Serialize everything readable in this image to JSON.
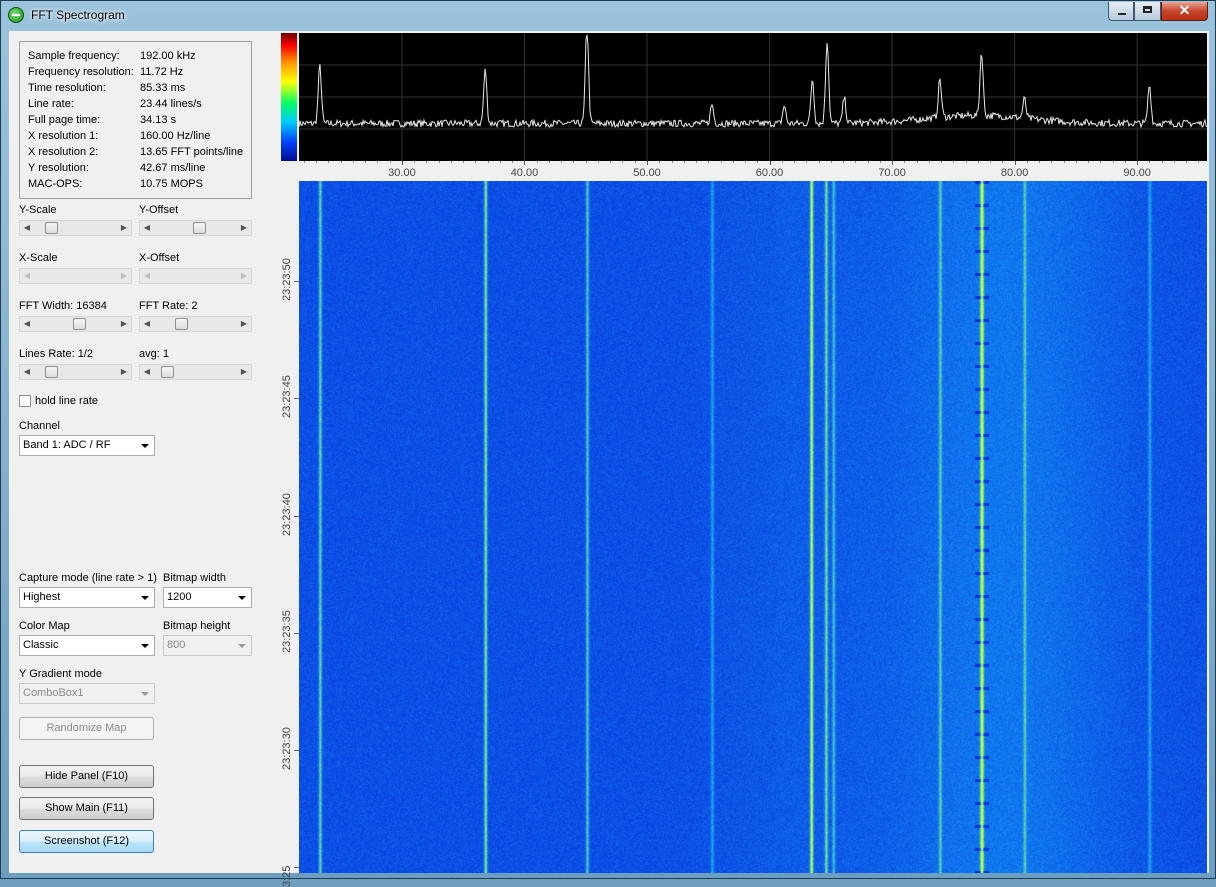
{
  "window": {
    "title": "FFT Spectrogram"
  },
  "info": [
    {
      "key": "Sample frequency:",
      "value": "192.00 kHz"
    },
    {
      "key": "Frequency resolution:",
      "value": "11.72 Hz"
    },
    {
      "key": "Time resolution:",
      "value": "85.33 ms"
    },
    {
      "key": "Line rate:",
      "value": "23.44 lines/s"
    },
    {
      "key": "Full page time:",
      "value": "34.13 s"
    },
    {
      "key": "X resolution 1:",
      "value": "160.00 Hz/line"
    },
    {
      "key": "X resolution 2:",
      "value": "13.65 FFT points/line"
    },
    {
      "key": "Y resolution:",
      "value": "42.67 ms/line"
    },
    {
      "key": "MAC-OPS:",
      "value": "10.75 MOPS"
    }
  ],
  "controls": {
    "y_scale_label": "Y-Scale",
    "y_offset_label": "Y-Offset",
    "x_scale_label": "X-Scale",
    "x_offset_label": "X-Offset",
    "fft_width_label": "FFT Width: 16384",
    "fft_rate_label": "FFT Rate: 2",
    "lines_rate_label": "Lines Rate: 1/2",
    "avg_label": "avg: 1",
    "sliders": {
      "y_scale": 0.15,
      "y_offset": 0.55,
      "fft_width": 0.55,
      "fft_rate": 0.3,
      "lines_rate": 0.15,
      "avg": 0.1
    },
    "hold_label": "hold line rate",
    "hold_checked": false,
    "channel_label": "Channel",
    "channel_value": "Band 1: ADC / RF",
    "capture_label": "Capture mode (line rate > 1)",
    "capture_value": "Highest",
    "bitmap_width_label": "Bitmap width",
    "bitmap_width_value": "1200",
    "color_map_label": "Color Map",
    "color_map_value": "Classic",
    "bitmap_height_label": "Bitmap height",
    "bitmap_height_value": "800",
    "gradient_label": "Y Gradient mode",
    "gradient_value": "ComboBox1",
    "randomize_label": "Randomize Map",
    "hide_panel_label": "Hide Panel (F10)",
    "show_main_label": "Show Main (F11)",
    "screenshot_label": "Screenshot (F12)"
  },
  "spectrum": {
    "x_ticks": [
      "30.00",
      "40.00",
      "50.00",
      "60.00",
      "70.00",
      "80.00",
      "90.00"
    ],
    "x_range": [
      21.6,
      95.7
    ],
    "peaks": [
      {
        "f": 23.3,
        "h": 0.45
      },
      {
        "f": 36.8,
        "h": 0.42
      },
      {
        "f": 45.1,
        "h": 0.78
      },
      {
        "f": 55.3,
        "h": 0.15
      },
      {
        "f": 61.2,
        "h": 0.14
      },
      {
        "f": 63.5,
        "h": 0.35
      },
      {
        "f": 64.7,
        "h": 0.65
      },
      {
        "f": 66.1,
        "h": 0.2
      },
      {
        "f": 73.9,
        "h": 0.3
      },
      {
        "f": 77.3,
        "h": 0.5
      },
      {
        "f": 80.8,
        "h": 0.15
      },
      {
        "f": 91.0,
        "h": 0.3
      }
    ]
  },
  "waterfall": {
    "y_labels": [
      "23:23:50",
      "23:23:45",
      "23:23:40",
      "23:23:35",
      "23:23:30",
      "3:25"
    ],
    "lines": [
      {
        "f": 23.3,
        "s": 0.6
      },
      {
        "f": 36.8,
        "s": 0.7
      },
      {
        "f": 45.1,
        "s": 0.55
      },
      {
        "f": 55.3,
        "s": 0.35
      },
      {
        "f": 63.4,
        "s": 0.85
      },
      {
        "f": 64.6,
        "s": 0.6
      },
      {
        "f": 65.2,
        "s": 0.45
      },
      {
        "f": 73.9,
        "s": 0.45
      },
      {
        "f": 77.3,
        "s": 1.0
      },
      {
        "f": 80.8,
        "s": 0.4
      },
      {
        "f": 91.0,
        "s": 0.35
      }
    ]
  }
}
